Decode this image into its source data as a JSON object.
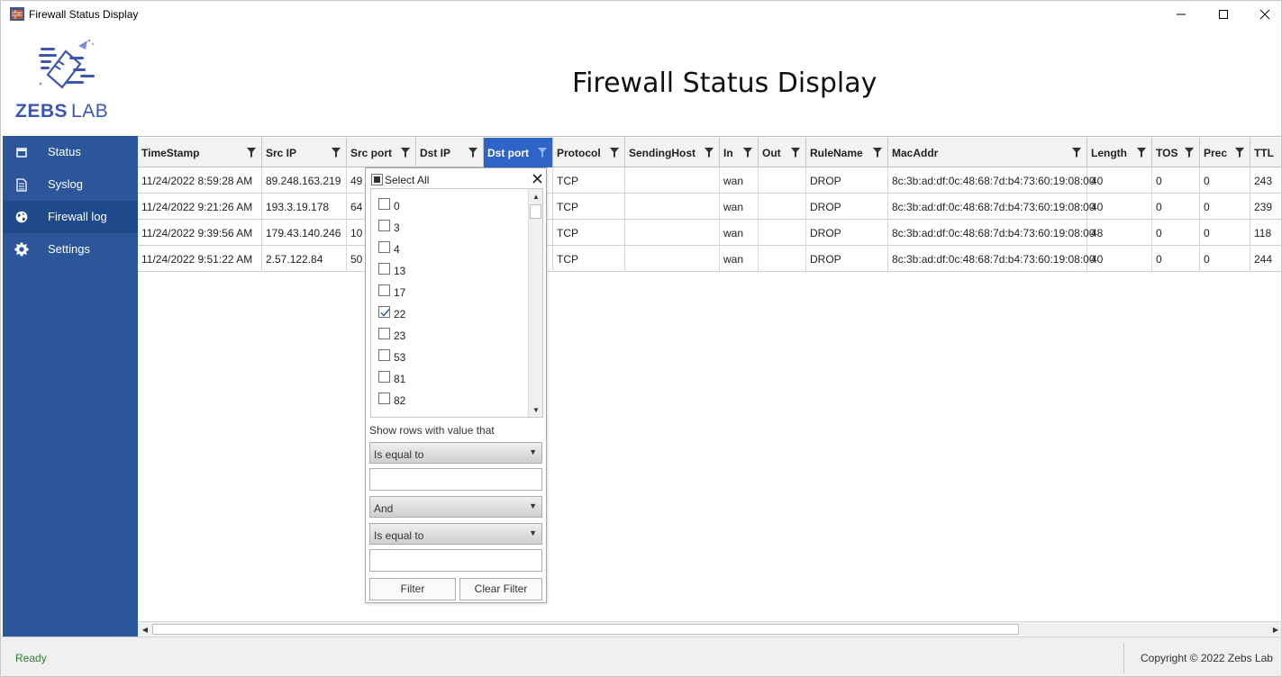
{
  "window": {
    "title": "Firewall Status Display",
    "controls": [
      "minimize",
      "maximize",
      "close"
    ]
  },
  "header": {
    "logo_text_bold": "ZEBS",
    "logo_text_light": "LAB",
    "app_title": "Firewall Status Display"
  },
  "sidebar": {
    "items": [
      {
        "label": "Status",
        "icon": "window-icon"
      },
      {
        "label": "Syslog",
        "icon": "document-icon"
      },
      {
        "label": "Firewall log",
        "icon": "globe-icon",
        "active": true
      },
      {
        "label": "Settings",
        "icon": "gear-icon"
      }
    ]
  },
  "grid": {
    "columns": [
      "TimeStamp",
      "Src IP",
      "Src port",
      "Dst IP",
      "Dst port",
      "Protocol",
      "SendingHost",
      "In",
      "Out",
      "RuleName",
      "MacAddr",
      "Length",
      "TOS",
      "Prec",
      "TTL"
    ],
    "selected_column": "Dst port",
    "rows": [
      [
        "11/24/2022 8:59:28 AM",
        "89.248.163.219",
        "49",
        "",
        "",
        "TCP",
        "",
        "wan",
        "",
        "DROP",
        "8c:3b:ad:df:0c:48:68:7d:b4:73:60:19:08:00",
        "40",
        "0",
        "0",
        "243"
      ],
      [
        "11/24/2022 9:21:26 AM",
        "193.3.19.178",
        "64",
        "",
        "",
        "TCP",
        "",
        "wan",
        "",
        "DROP",
        "8c:3b:ad:df:0c:48:68:7d:b4:73:60:19:08:00",
        "40",
        "0",
        "0",
        "239"
      ],
      [
        "11/24/2022 9:39:56 AM",
        "179.43.140.246",
        "10",
        "",
        "",
        "TCP",
        "",
        "wan",
        "",
        "DROP",
        "8c:3b:ad:df:0c:48:68:7d:b4:73:60:19:08:00",
        "48",
        "0",
        "0",
        "118"
      ],
      [
        "11/24/2022 9:51:22 AM",
        "2.57.122.84",
        "50",
        "",
        "",
        "TCP",
        "",
        "wan",
        "",
        "DROP",
        "8c:3b:ad:df:0c:48:68:7d:b4:73:60:19:08:00",
        "40",
        "0",
        "0",
        "244"
      ]
    ]
  },
  "filter_popup": {
    "select_all_label": "Select All",
    "values": [
      {
        "value": "0",
        "checked": false
      },
      {
        "value": "3",
        "checked": false
      },
      {
        "value": "4",
        "checked": false
      },
      {
        "value": "13",
        "checked": false
      },
      {
        "value": "17",
        "checked": false
      },
      {
        "value": "22",
        "checked": true
      },
      {
        "value": "23",
        "checked": false
      },
      {
        "value": "53",
        "checked": false
      },
      {
        "value": "81",
        "checked": false
      },
      {
        "value": "82",
        "checked": false
      }
    ],
    "show_rows_label": "Show rows with value that",
    "operator1": "Is equal to",
    "value1": "",
    "logic": "And",
    "operator2": "Is equal to",
    "value2": "",
    "filter_button": "Filter",
    "clear_button": "Clear Filter"
  },
  "statusbar": {
    "status": "Ready",
    "copyright": "Copyright © 2022 Zebs Lab"
  },
  "colors": {
    "sidebar": "#2b579a",
    "accent": "#3d56b1",
    "selected_header": "#2e64c8",
    "ready": "#2e7d32"
  }
}
